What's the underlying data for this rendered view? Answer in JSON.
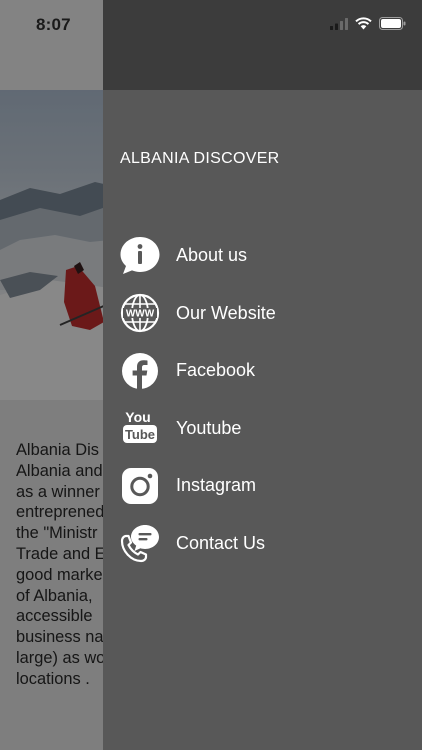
{
  "status_bar": {
    "time": "8:07"
  },
  "background": {
    "body_text": "Albania Dis\nAlbania and\nas a winner\nentreprened\nthe \"Ministr\nTrade and E\ngood marke\nof Albania,\naccessible\nbusiness na\nlarge) as wo\nlocations ."
  },
  "drawer": {
    "title": "ALBANIA DISCOVER",
    "items": [
      {
        "label": "About us",
        "icon": "info-icon"
      },
      {
        "label": "Our Website",
        "icon": "globe-www-icon"
      },
      {
        "label": "Facebook",
        "icon": "facebook-icon"
      },
      {
        "label": "Youtube",
        "icon": "youtube-icon"
      },
      {
        "label": "Instagram",
        "icon": "instagram-icon"
      },
      {
        "label": "Contact Us",
        "icon": "contact-phone-chat-icon"
      }
    ]
  },
  "colors": {
    "drawer_background": "#585858",
    "drawer_header": "#3c3c3c",
    "text": "#ffffff"
  }
}
